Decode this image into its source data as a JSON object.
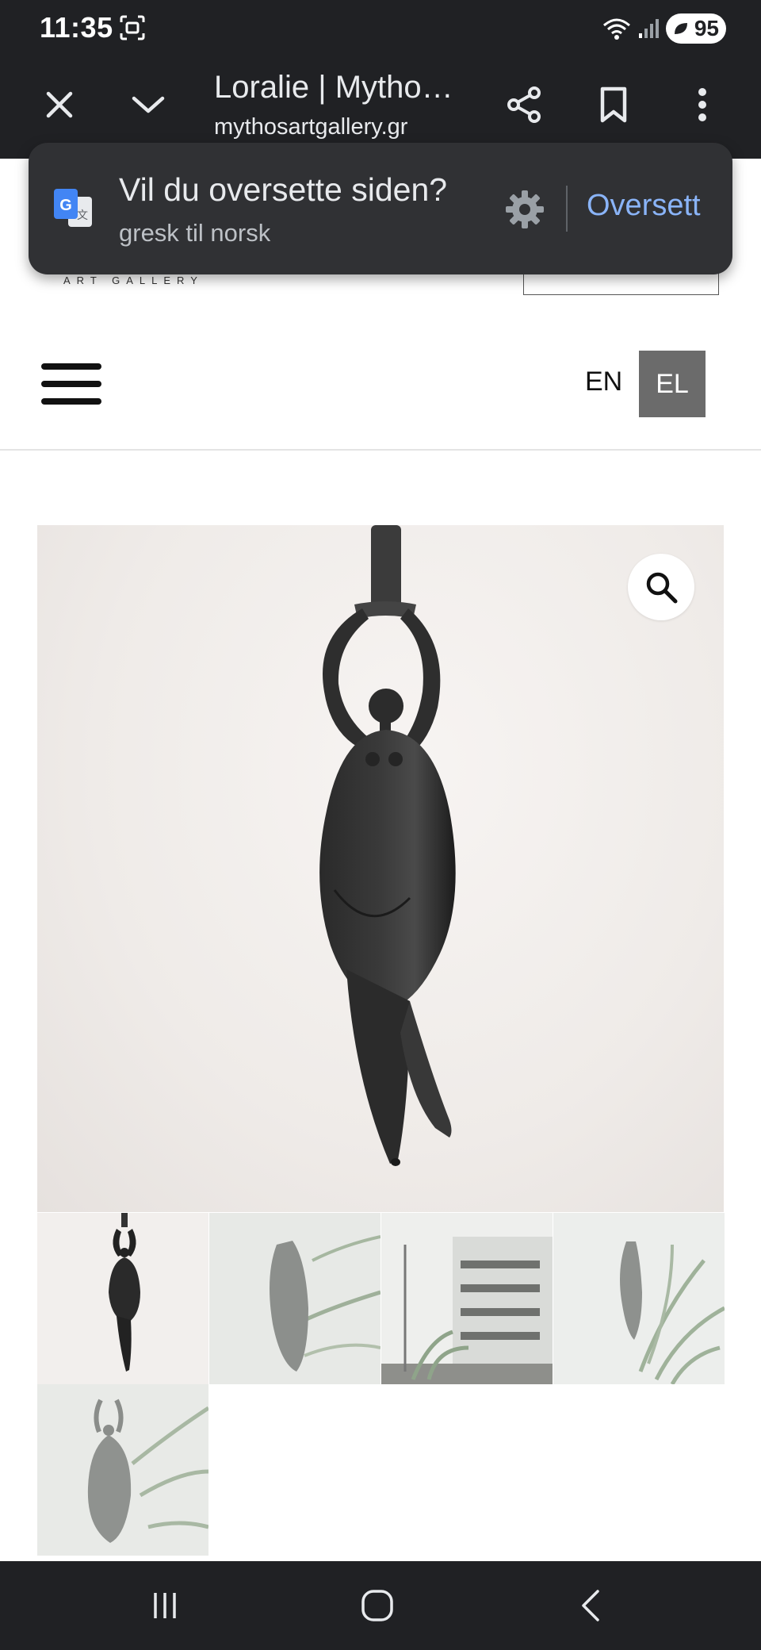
{
  "status_bar": {
    "time": "11:35",
    "battery": "95",
    "icons": [
      "screenshot-icon",
      "wifi-icon",
      "signal-icon",
      "battery-saver-icon"
    ]
  },
  "toolbar": {
    "title": "Loralie | Mytho…",
    "url": "mythosartgallery.gr",
    "icons": [
      "close-icon",
      "chevron-down-icon",
      "share-icon",
      "bookmark-icon",
      "more-vert-icon"
    ]
  },
  "translate_bar": {
    "question": "Vil du oversette siden?",
    "languages": "gresk til norsk",
    "action_label": "Oversett"
  },
  "site_header": {
    "logo_subtext": "ART GALLERY",
    "languages": [
      {
        "code": "EN",
        "active": false
      },
      {
        "code": "EL",
        "active": true
      }
    ]
  },
  "gallery": {
    "thumbnail_count": 5
  },
  "colors": {
    "chrome": "#202124",
    "translate_bar": "#303134",
    "accent_link": "#8ab4f8",
    "lang_active": "#6b6b6b"
  }
}
